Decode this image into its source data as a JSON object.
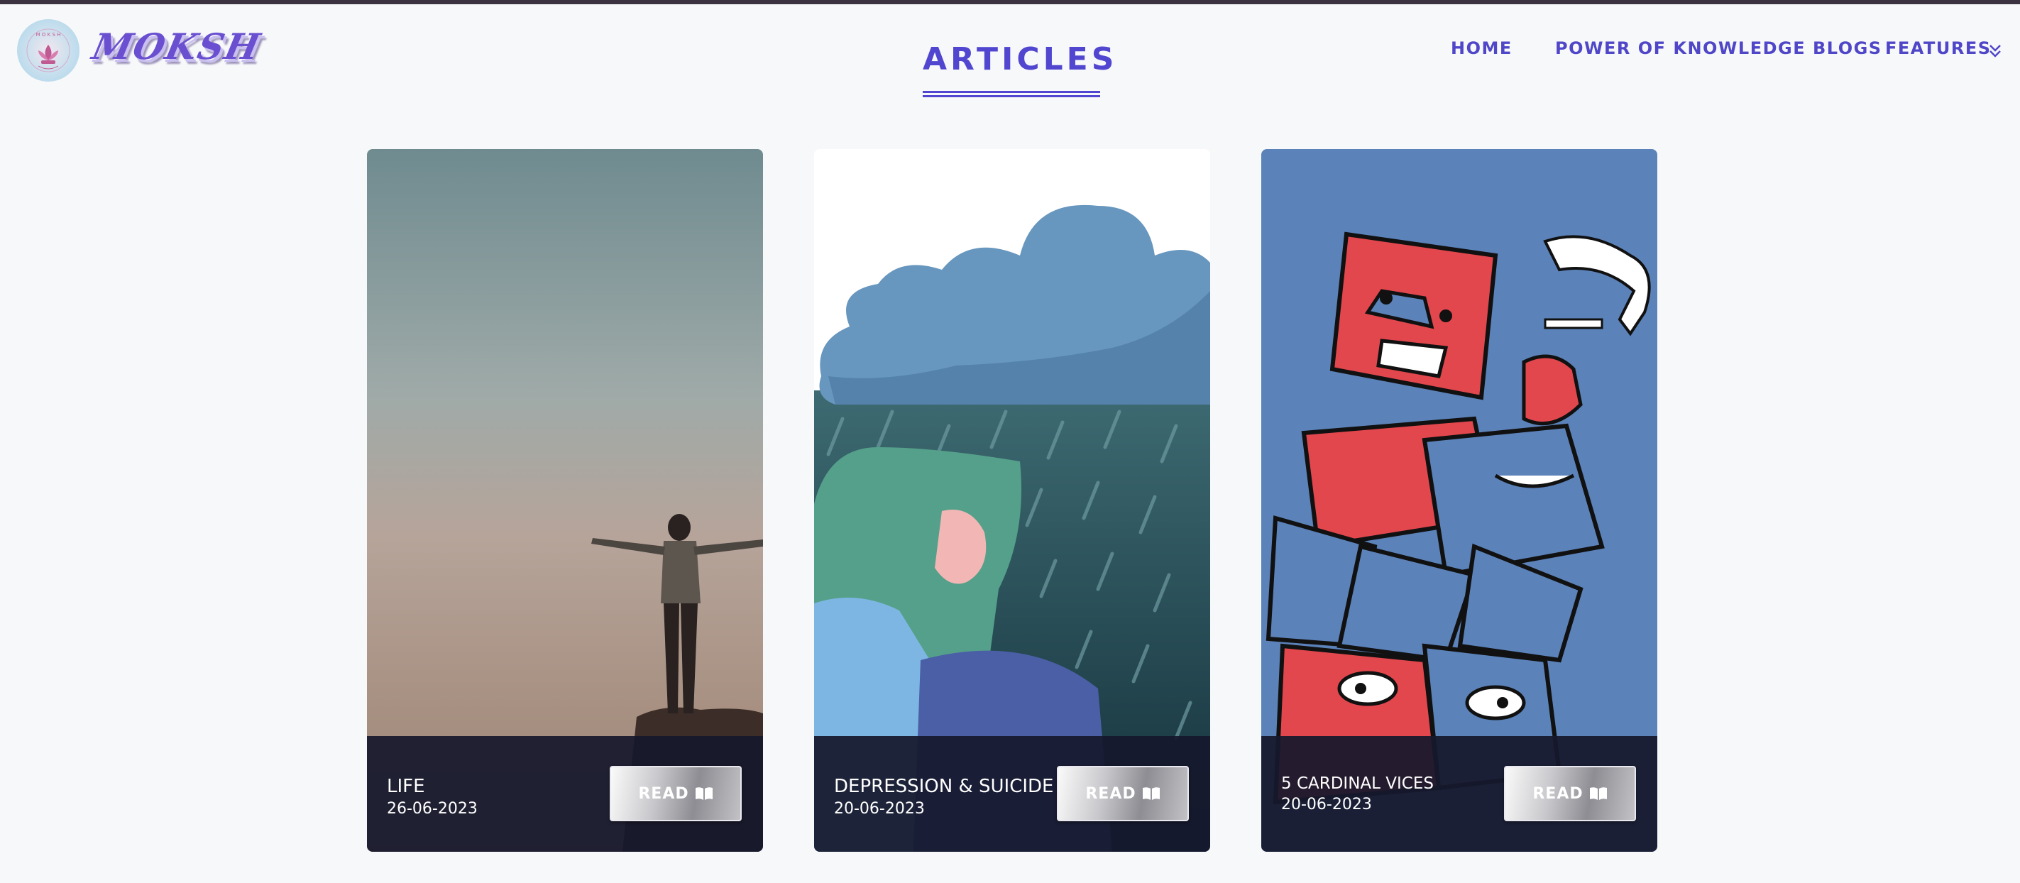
{
  "brand": {
    "name": "MOKSH",
    "logo_icon": "lotus-emblem-icon"
  },
  "header": {
    "title": "ARTICLES"
  },
  "nav": {
    "items": [
      {
        "label": "HOME"
      },
      {
        "label": "POWER OF KNOWLEDGE BLOGS"
      },
      {
        "label": "FEATURES",
        "icon": "double-chevron-down-icon"
      }
    ]
  },
  "articles": [
    {
      "title": "LIFE",
      "date": "26-06-2023",
      "button_label": "READ",
      "button_icon": "open-book-icon",
      "image": "person-on-cliff-at-dusk"
    },
    {
      "title": "DEPRESSION & SUICIDE",
      "date": "20-06-2023",
      "button_label": "READ",
      "button_icon": "open-book-icon",
      "image": "sad-girl-under-rain-cloud"
    },
    {
      "title": "5 CARDINAL VICES",
      "date": "20-06-2023",
      "button_label": "READ",
      "button_icon": "open-book-icon",
      "image": "abstract-red-blue-figures"
    }
  ],
  "colors": {
    "accent": "#5146cf",
    "card_footer": "#16182c",
    "page_bg": "#f7f8fa"
  }
}
